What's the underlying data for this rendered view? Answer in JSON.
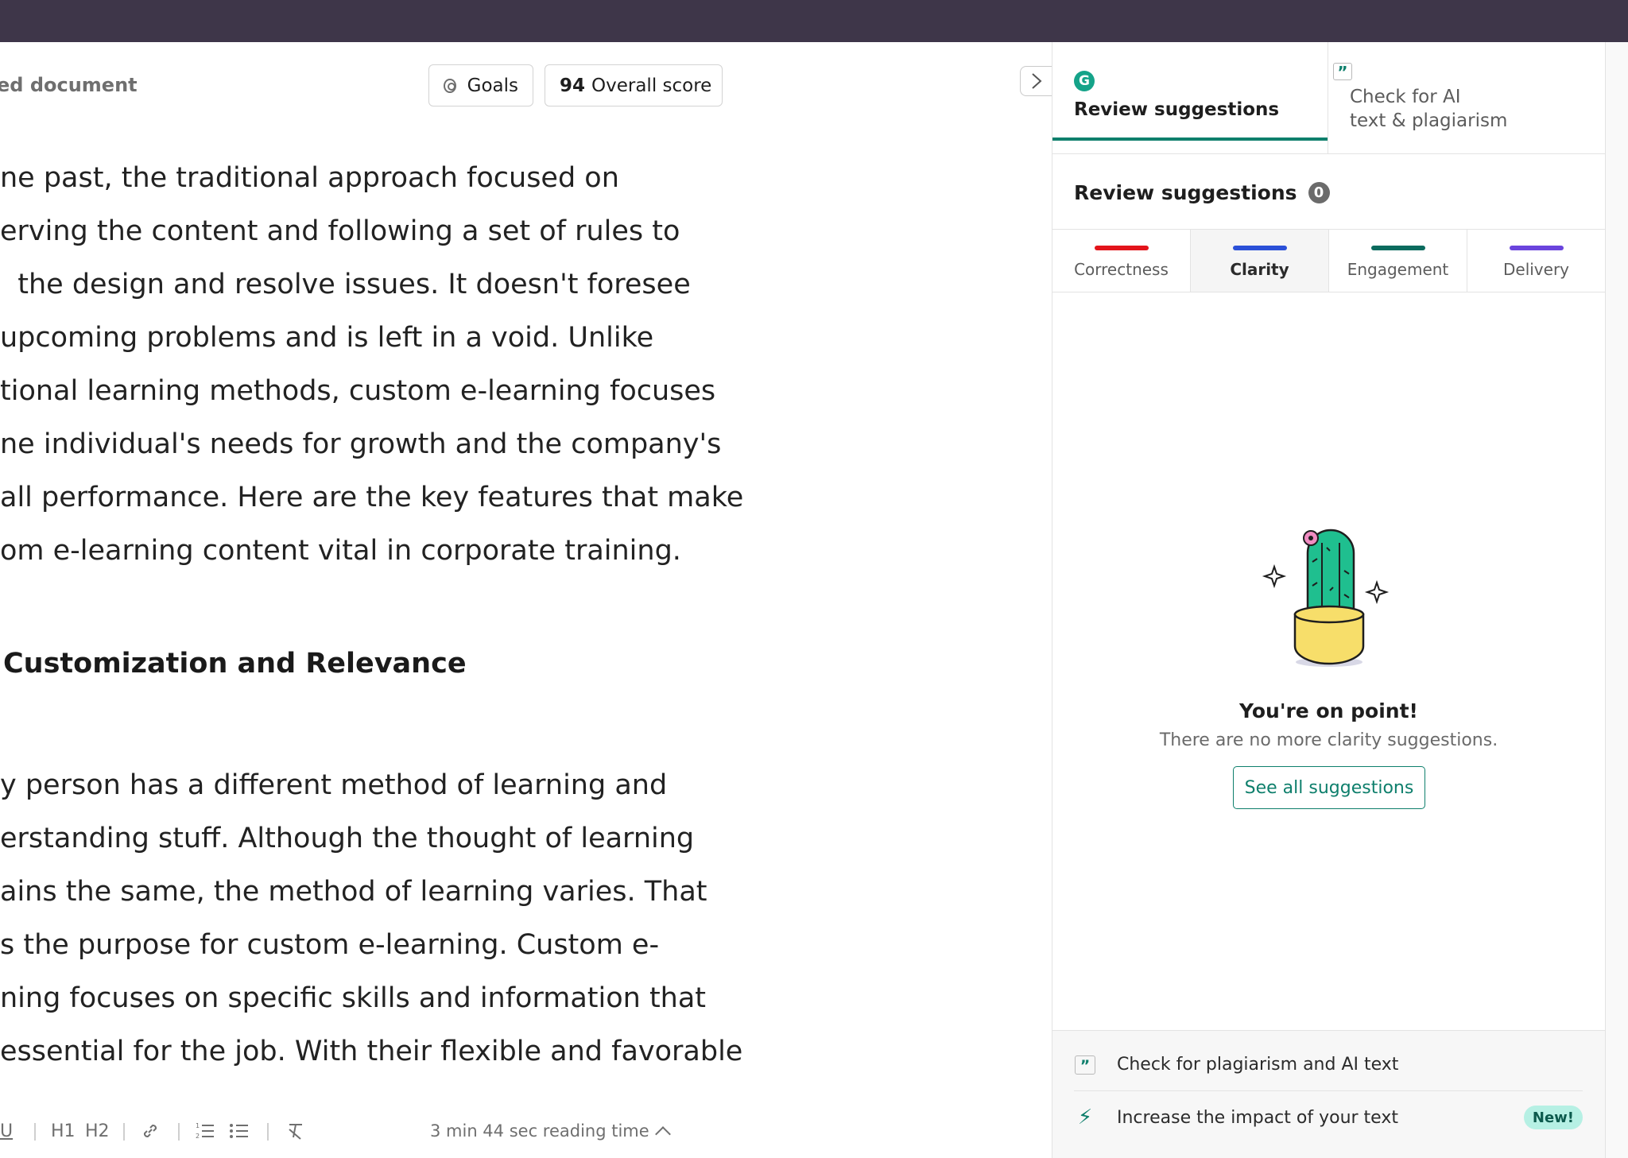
{
  "editor": {
    "doc_title": "ed document",
    "goals_label": "Goals",
    "score_value": "94",
    "score_label": "Overall score",
    "paragraph1": [
      "ne past, the traditional approach focused on",
      "erving the content and following a set of rules to",
      "  the design and resolve issues. It doesn't foresee",
      "upcoming problems and is left in a void. Unlike",
      "tional learning methods, custom e-learning focuses",
      "ne individual's needs for growth and the company's",
      "all performance. Here are the key features that make",
      "om e-learning content vital in corporate training."
    ],
    "heading": "Customization and Relevance",
    "paragraph2": [
      "y person has a different method of learning and",
      "erstanding stuff. Although the thought of learning",
      "ains the same, the method of learning varies. That",
      "s the purpose for custom e-learning. Custom e-",
      "ning focuses on specific skills and information that",
      "essential for the job. With their flexible and favorable"
    ],
    "toolbar": {
      "underline": "U",
      "h1": "H1",
      "h2": "H2",
      "reading_time": "3 min 44 sec reading time"
    }
  },
  "sidebar": {
    "tab_review": "Review suggestions",
    "tab_ai_line1": "Check for AI",
    "tab_ai_line2": "text & plagiarism",
    "section_title": "Review suggestions",
    "count": "0",
    "categories": [
      {
        "label": "Correctness",
        "color": "#e3141b"
      },
      {
        "label": "Clarity",
        "color": "#2b50d8"
      },
      {
        "label": "Engagement",
        "color": "#0b6b5e"
      },
      {
        "label": "Delivery",
        "color": "#6a44dd"
      }
    ],
    "empty_title": "You're on point!",
    "empty_subtitle": "There are no more clarity suggestions.",
    "see_all_label": "See all suggestions",
    "footer": {
      "plagiarism_label": "Check for plagiarism and AI text",
      "impact_label": "Increase the impact of your text",
      "new_badge": "New!"
    }
  }
}
